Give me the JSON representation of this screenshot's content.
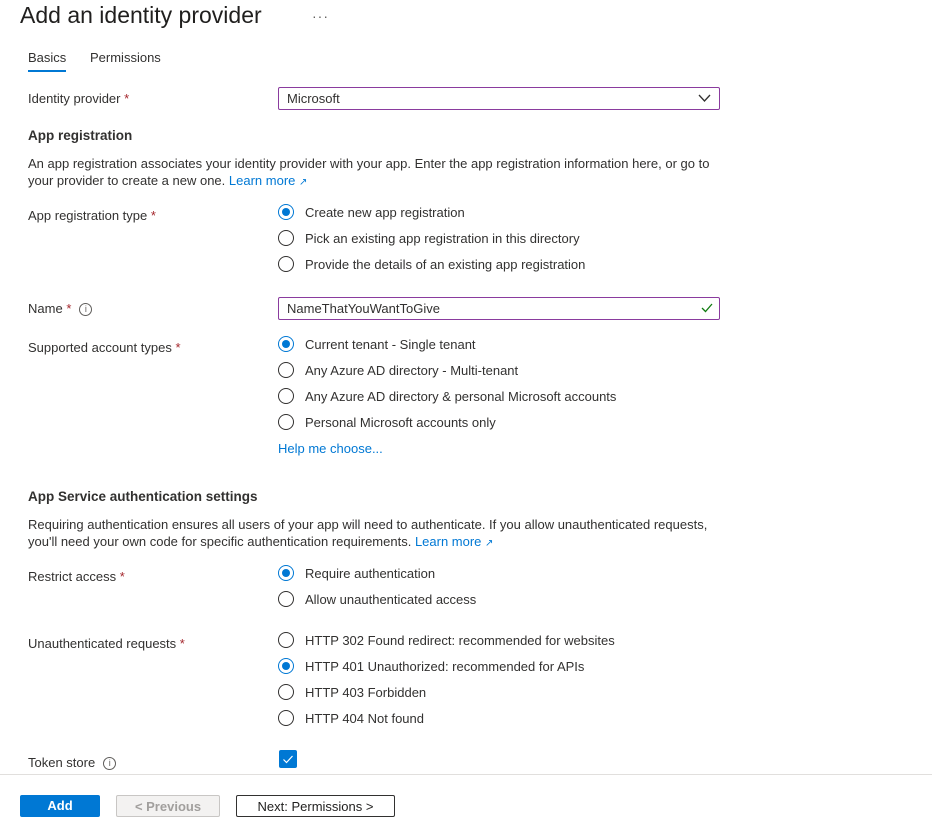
{
  "header": {
    "title": "Add an identity provider",
    "more": "···"
  },
  "tabs": [
    {
      "label": "Basics",
      "active": true
    },
    {
      "label": "Permissions"
    }
  ],
  "identity_provider": {
    "label": "Identity provider",
    "value": "Microsoft"
  },
  "app_registration": {
    "heading": "App registration",
    "desc1": "An app registration associates your identity provider with your app. Enter the app registration information here, or go to",
    "desc2": "your provider to create a new one.",
    "learn_more": "Learn more"
  },
  "app_reg_type": {
    "label": "App registration type",
    "options": [
      "Create new app registration",
      "Pick an existing app registration in this directory",
      "Provide the details of an existing app registration"
    ],
    "selected": 0
  },
  "name": {
    "label": "Name",
    "value": "NameThatYouWantToGive"
  },
  "account_types": {
    "label": "Supported account types",
    "options": [
      "Current tenant - Single tenant",
      "Any Azure AD directory - Multi-tenant",
      "Any Azure AD directory & personal Microsoft accounts",
      "Personal Microsoft accounts only"
    ],
    "selected": 0,
    "help": "Help me choose..."
  },
  "auth_settings": {
    "heading": "App Service authentication settings",
    "desc1": "Requiring authentication ensures all users of your app will need to authenticate. If you allow unauthenticated requests,",
    "desc2": "you'll need your own code for specific authentication requirements.",
    "learn_more": "Learn more"
  },
  "restrict_access": {
    "label": "Restrict access",
    "options": [
      "Require authentication",
      "Allow unauthenticated access"
    ],
    "selected": 0
  },
  "unauth_requests": {
    "label": "Unauthenticated requests",
    "options": [
      "HTTP 302 Found redirect: recommended for websites",
      "HTTP 401 Unauthorized: recommended for APIs",
      "HTTP 403 Forbidden",
      "HTTP 404 Not found"
    ],
    "selected": 1
  },
  "token_store": {
    "label": "Token store",
    "checked": true
  },
  "footer": {
    "add": "Add",
    "previous": "< Previous",
    "next": "Next: Permissions >"
  },
  "colors": {
    "accent": "#0078d4",
    "focus_border": "#8a3b9e",
    "required": "#a4262c",
    "valid": "#107c10"
  }
}
